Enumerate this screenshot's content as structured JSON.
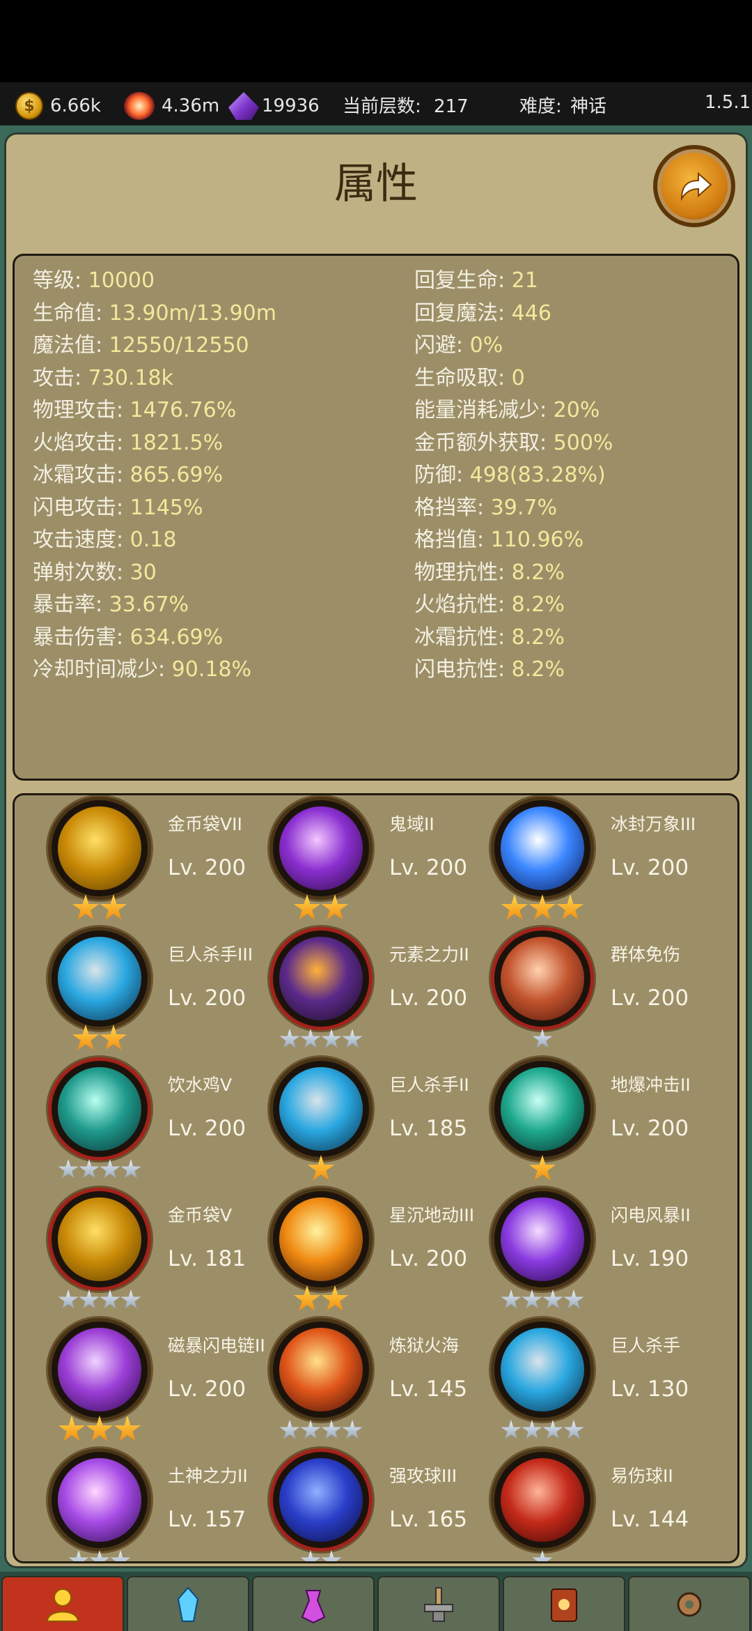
{
  "topbar": {
    "gold": "6.66k",
    "souls": "4.36m",
    "gems": "19936",
    "floor_label": "当前层数:",
    "floor_value": "217",
    "difficulty_label": "难度:",
    "difficulty_value": "神话",
    "version": "1.5.1"
  },
  "header": {
    "title": "属性",
    "back_icon": "arrow-forward-icon"
  },
  "stats_left": [
    {
      "label": "等级: ",
      "value": "10000"
    },
    {
      "label": "生命值: ",
      "value": "13.90m/13.90m"
    },
    {
      "label": "魔法值: ",
      "value": "12550/12550"
    },
    {
      "label": "攻击: ",
      "value": "730.18k"
    },
    {
      "label": "物理攻击: ",
      "value": "1476.76%"
    },
    {
      "label": "火焰攻击: ",
      "value": "1821.5%"
    },
    {
      "label": "冰霜攻击: ",
      "value": "865.69%"
    },
    {
      "label": "闪电攻击: ",
      "value": "1145%"
    },
    {
      "label": "攻击速度: ",
      "value": "0.18"
    },
    {
      "label": "弹射次数: ",
      "value": "30"
    },
    {
      "label": "暴击率: ",
      "value": "33.67%"
    },
    {
      "label": "暴击伤害: ",
      "value": "634.69%"
    },
    {
      "label": "冷却时间减少: ",
      "value": "90.18%"
    }
  ],
  "stats_right": [
    {
      "label": "回复生命: ",
      "value": "21"
    },
    {
      "label": "回复魔法: ",
      "value": "446"
    },
    {
      "label": "闪避: ",
      "value": "0%"
    },
    {
      "label": "生命吸取: ",
      "value": "0"
    },
    {
      "label": "能量消耗减少: ",
      "value": "20%"
    },
    {
      "label": "金币额外获取: ",
      "value": "500%"
    },
    {
      "label": "防御: ",
      "value": "498(83.28%)"
    },
    {
      "label": "格挡率: ",
      "value": "39.7%"
    },
    {
      "label": "格挡值: ",
      "value": "110.96%"
    },
    {
      "label": "物理抗性: ",
      "value": "8.2%"
    },
    {
      "label": "火焰抗性: ",
      "value": "8.2%"
    },
    {
      "label": "冰霜抗性: ",
      "value": "8.2%"
    },
    {
      "label": "闪电抗性: ",
      "value": "8.2%"
    }
  ],
  "skills": [
    {
      "name": "金币袋VII",
      "level": "Lv. 200",
      "stars": 2,
      "star_type": "gold",
      "icon": "coin-bag-icon",
      "colors": [
        "#ffe066",
        "#c98a07",
        "#5a3b00"
      ],
      "red_ring": false
    },
    {
      "name": "鬼域II",
      "level": "Lv. 200",
      "stars": 2,
      "star_type": "gold",
      "icon": "ghost-domain-icon",
      "colors": [
        "#f3c7ff",
        "#8a2fd0",
        "#2a0a3d"
      ],
      "red_ring": false
    },
    {
      "name": "冰封万象III",
      "level": "Lv. 200",
      "stars": 3,
      "star_type": "gold",
      "icon": "ice-crystal-icon",
      "colors": [
        "#ffffff",
        "#3a86ff",
        "#0b1a55"
      ],
      "red_ring": false
    },
    {
      "name": "巨人杀手III",
      "level": "Lv. 200",
      "stars": 2,
      "star_type": "gold",
      "icon": "stone-fist-icon",
      "colors": [
        "#d9e3ea",
        "#2aa7e0",
        "#0a2b44"
      ],
      "red_ring": false
    },
    {
      "name": "元素之力II",
      "level": "Lv. 200",
      "stars": 4,
      "star_type": "silver",
      "icon": "element-force-icon",
      "colors": [
        "#ffb23a",
        "#5b2a8a",
        "#1a0c20"
      ],
      "red_ring": true
    },
    {
      "name": "群体免伤",
      "level": "Lv. 200",
      "stars": 1,
      "star_type": "silver",
      "icon": "shield-icon",
      "colors": [
        "#ffd2b0",
        "#c2542e",
        "#4a1208"
      ],
      "red_ring": true
    },
    {
      "name": "饮水鸡V",
      "level": "Lv. 200",
      "stars": 4,
      "star_type": "silver",
      "icon": "water-slash-icon",
      "colors": [
        "#b8fff0",
        "#1f9a8c",
        "#0a2b2e"
      ],
      "red_ring": true
    },
    {
      "name": "巨人杀手II",
      "level": "Lv. 185",
      "stars": 1,
      "star_type": "gold",
      "icon": "stone-fist-icon",
      "colors": [
        "#d9e3ea",
        "#2aa7e0",
        "#0a2b44"
      ],
      "red_ring": false
    },
    {
      "name": "地爆冲击II",
      "level": "Lv. 200",
      "stars": 1,
      "star_type": "gold",
      "icon": "ground-spike-icon",
      "colors": [
        "#c9fff4",
        "#1fa98e",
        "#062a24"
      ],
      "red_ring": false
    },
    {
      "name": "金币袋V",
      "level": "Lv. 181",
      "stars": 4,
      "star_type": "silver",
      "icon": "coin-bag-icon",
      "colors": [
        "#ffe066",
        "#c98a07",
        "#5a3b00"
      ],
      "red_ring": true
    },
    {
      "name": "星沉地动III",
      "level": "Lv. 200",
      "stars": 2,
      "star_type": "gold",
      "icon": "meteor-quake-icon",
      "colors": [
        "#fff3a0",
        "#f08a12",
        "#4a1a04"
      ],
      "red_ring": false
    },
    {
      "name": "闪电风暴II",
      "level": "Lv. 190",
      "stars": 4,
      "star_type": "silver",
      "icon": "lightning-storm-icon",
      "colors": [
        "#f4dcff",
        "#8a3be0",
        "#22063e"
      ],
      "red_ring": false
    },
    {
      "name": "磁暴闪电链II",
      "level": "Lv. 200",
      "stars": 3,
      "star_type": "gold",
      "icon": "chain-lightning-icon",
      "colors": [
        "#f0d2ff",
        "#9b3ed6",
        "#2a0845"
      ],
      "red_ring": false
    },
    {
      "name": "炼狱火海",
      "level": "Lv. 145",
      "stars": 4,
      "star_type": "silver",
      "icon": "inferno-icon",
      "colors": [
        "#ffe08a",
        "#e0561a",
        "#3a0c04"
      ],
      "red_ring": false
    },
    {
      "name": "巨人杀手",
      "level": "Lv. 130",
      "stars": 4,
      "star_type": "silver",
      "icon": "stone-fist-icon",
      "colors": [
        "#d9e3ea",
        "#2aa7e0",
        "#0a2b44"
      ],
      "red_ring": false
    },
    {
      "name": "土神之力II",
      "level": "Lv. 157",
      "stars": 3,
      "star_type": "silver",
      "icon": "earth-god-icon",
      "colors": [
        "#ffd6ff",
        "#a64be6",
        "#2a0a4a"
      ],
      "red_ring": false
    },
    {
      "name": "强攻球III",
      "level": "Lv. 165",
      "stars": 2,
      "star_type": "silver",
      "icon": "power-orb-icon",
      "colors": [
        "#8fb0ff",
        "#2a3ec9",
        "#0a0c3a"
      ],
      "red_ring": true
    },
    {
      "name": "易伤球II",
      "level": "Lv. 144",
      "stars": 1,
      "star_type": "silver",
      "icon": "vulnerable-orb-icon",
      "colors": [
        "#ffb59a",
        "#c42a1a",
        "#3a0604"
      ],
      "red_ring": false
    }
  ],
  "nav": [
    {
      "icon": "hero-icon",
      "active": true
    },
    {
      "icon": "crystal-icon",
      "active": false
    },
    {
      "icon": "potion-icon",
      "active": false
    },
    {
      "icon": "anvil-icon",
      "active": false
    },
    {
      "icon": "spellbook-icon",
      "active": false
    },
    {
      "icon": "gear-icon",
      "active": false
    }
  ]
}
